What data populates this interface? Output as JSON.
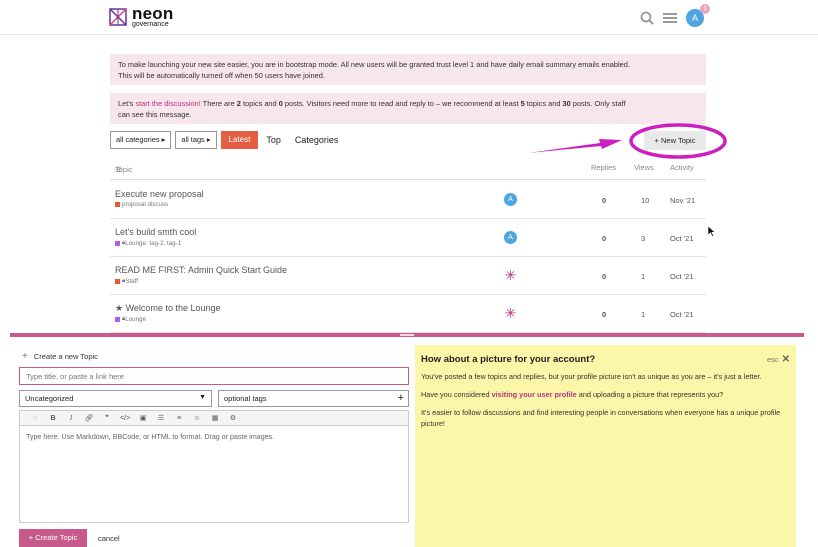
{
  "header": {
    "brand": "neon",
    "brand_sub": "governance",
    "avatar_letter": "A",
    "notification_count": "1",
    "search_icon": "search-icon",
    "menu_icon": "hamburger-menu-icon"
  },
  "banners": {
    "bootstrap_1": "To make launching your new site easier, you are in bootstrap mode. All new users will be granted trust level 1 and have daily email summary emails enabled.",
    "bootstrap_2": "This will be automatically turned off when 50 users have joined.",
    "discuss_1": "Let's ",
    "discuss_link": "start the discussion!",
    "discuss_2": " There are ",
    "discuss_topics": "2",
    "discuss_3": " topics and ",
    "discuss_posts": "0",
    "discuss_4": " posts. Visitors need more to read and reply to – we recommend at least ",
    "discuss_min_topics": "5",
    "discuss_5": " topics and ",
    "discuss_min_posts": "30",
    "discuss_6": " posts. Only staff",
    "discuss_7": "can see this message."
  },
  "nav": {
    "categories_dd": "all categories",
    "tags_dd": "all tags",
    "latest": "Latest",
    "top": "Top",
    "categories": "Categories",
    "new_topic": "New Topic"
  },
  "table": {
    "col_topic": "Topic",
    "col_replies": "Replies",
    "col_views": "Views",
    "col_activity": "Activity",
    "rows": [
      {
        "title": "Execute new proposal",
        "category": "proposal discuss",
        "cat_color": "#e45735",
        "tags": "",
        "avatar": "A",
        "replies": "0",
        "views": "10",
        "activity": "Nov '21"
      },
      {
        "title": "Let's build smth cool",
        "category": "Lounge",
        "cat_color": "#a461ef",
        "tags": "tag-2, tag-1",
        "avatar": "A",
        "replies": "0",
        "views": "3",
        "activity": "Oct '21"
      },
      {
        "title": "READ ME FIRST: Admin Quick Start Guide",
        "category": "Staff",
        "cat_color": "#e45735",
        "tags": "",
        "avatar": "✳",
        "replies": "0",
        "views": "1",
        "activity": "Oct '21"
      },
      {
        "title": "Welcome to the Lounge",
        "category": "Lounge",
        "cat_color": "#a461ef",
        "tags": "",
        "avatar": "✳",
        "replies": "0",
        "views": "1",
        "activity": "Oct '21"
      }
    ]
  },
  "composer": {
    "header": "Create a new Topic",
    "title_placeholder": "Type title, or paste a link here",
    "category": "Uncategorized",
    "tags_placeholder": "optional tags",
    "editor_placeholder": "Type here. Use Markdown, BBCode, or HTML to format. Drag or paste images.",
    "create_button": "Create Topic",
    "cancel": "cancel"
  },
  "tip": {
    "title": "How about a picture for your account?",
    "close": "esc",
    "p1": "You've posted a few topics and replies, but your profile picture isn't as unique as you are – it's just a letter.",
    "p2a": "Have you considered ",
    "p2_link": "visiting your user profile",
    "p2b": " and uploading a picture that represents you?",
    "p3": "It's easier to follow discussions and find interesting people in conversations when everyone has a unique profile picture!"
  },
  "colors": {
    "accent": "#e55e42",
    "brand_pink": "#c65a8c",
    "link": "#b6347f",
    "annotation": "#cc1fbf",
    "tip_bg": "#fcf6a8"
  }
}
